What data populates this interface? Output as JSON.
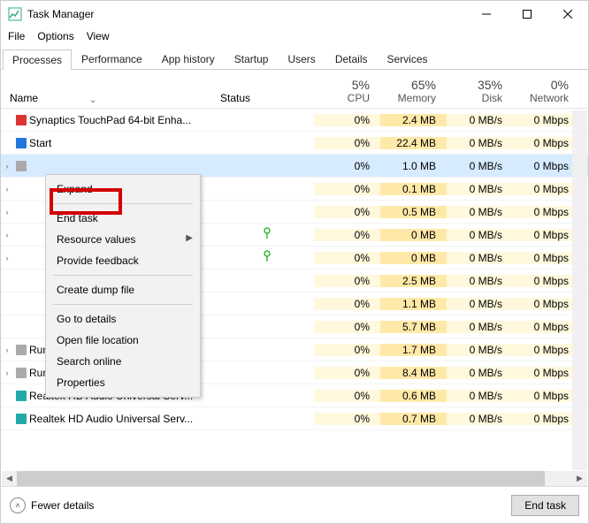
{
  "window": {
    "title": "Task Manager"
  },
  "menu": {
    "file": "File",
    "options": "Options",
    "view": "View"
  },
  "tabs": [
    "Processes",
    "Performance",
    "App history",
    "Startup",
    "Users",
    "Details",
    "Services"
  ],
  "active_tab": 0,
  "columns": {
    "name": "Name",
    "status": "Status",
    "cpu": {
      "pct": "5%",
      "label": "CPU"
    },
    "memory": {
      "pct": "65%",
      "label": "Memory"
    },
    "disk": {
      "pct": "35%",
      "label": "Disk"
    },
    "network": {
      "pct": "0%",
      "label": "Network"
    }
  },
  "rows": [
    {
      "exp": "",
      "name": "Synaptics TouchPad 64-bit Enha...",
      "status": "",
      "cpu": "0%",
      "mem": "2.4 MB",
      "disk": "0 MB/s",
      "net": "0 Mbps",
      "icon": "red"
    },
    {
      "exp": "",
      "name": "Start",
      "status": "",
      "cpu": "0%",
      "mem": "22.4 MB",
      "disk": "0 MB/s",
      "net": "0 Mbps",
      "icon": "blue"
    },
    {
      "exp": ">",
      "name": "",
      "status": "",
      "cpu": "0%",
      "mem": "1.0 MB",
      "disk": "0 MB/s",
      "net": "0 Mbps",
      "icon": "gray",
      "selected": true
    },
    {
      "exp": ">",
      "name": "",
      "status": "",
      "cpu": "0%",
      "mem": "0.1 MB",
      "disk": "0 MB/s",
      "net": "0 Mbps",
      "icon": ""
    },
    {
      "exp": ">",
      "name": "",
      "status": "",
      "cpu": "0%",
      "mem": "0.5 MB",
      "disk": "0 MB/s",
      "net": "0 Mbps",
      "icon": ""
    },
    {
      "exp": ">",
      "name": "",
      "status": "leaf",
      "cpu": "0%",
      "mem": "0 MB",
      "disk": "0 MB/s",
      "net": "0 Mbps",
      "icon": ""
    },
    {
      "exp": ">",
      "name": "",
      "status": "leaf",
      "cpu": "0%",
      "mem": "0 MB",
      "disk": "0 MB/s",
      "net": "0 Mbps",
      "icon": ""
    },
    {
      "exp": "",
      "name": "",
      "status": "",
      "cpu": "0%",
      "mem": "2.5 MB",
      "disk": "0 MB/s",
      "net": "0 Mbps",
      "icon": ""
    },
    {
      "exp": "",
      "name": "",
      "status": "",
      "cpu": "0%",
      "mem": "1.1 MB",
      "disk": "0 MB/s",
      "net": "0 Mbps",
      "icon": ""
    },
    {
      "exp": "",
      "name": "",
      "status": "",
      "cpu": "0%",
      "mem": "5.7 MB",
      "disk": "0 MB/s",
      "net": "0 Mbps",
      "icon": ""
    },
    {
      "exp": ">",
      "name": "Runtime Broker",
      "status": "",
      "cpu": "0%",
      "mem": "1.7 MB",
      "disk": "0 MB/s",
      "net": "0 Mbps",
      "icon": "gray"
    },
    {
      "exp": ">",
      "name": "Runtime Broker",
      "status": "",
      "cpu": "0%",
      "mem": "8.4 MB",
      "disk": "0 MB/s",
      "net": "0 Mbps",
      "icon": "gray"
    },
    {
      "exp": "",
      "name": "Realtek HD Audio Universal Serv...",
      "status": "",
      "cpu": "0%",
      "mem": "0.6 MB",
      "disk": "0 MB/s",
      "net": "0 Mbps",
      "icon": "teal"
    },
    {
      "exp": "",
      "name": "Realtek HD Audio Universal Serv...",
      "status": "",
      "cpu": "0%",
      "mem": "0.7 MB",
      "disk": "0 MB/s",
      "net": "0 Mbps",
      "icon": "teal"
    }
  ],
  "context_menu": {
    "expand": "Expand",
    "end_task": "End task",
    "resource_values": "Resource values",
    "provide_feedback": "Provide feedback",
    "create_dump": "Create dump file",
    "go_to_details": "Go to details",
    "open_location": "Open file location",
    "search_online": "Search online",
    "properties": "Properties"
  },
  "footer": {
    "fewer": "Fewer details",
    "end_task": "End task"
  }
}
